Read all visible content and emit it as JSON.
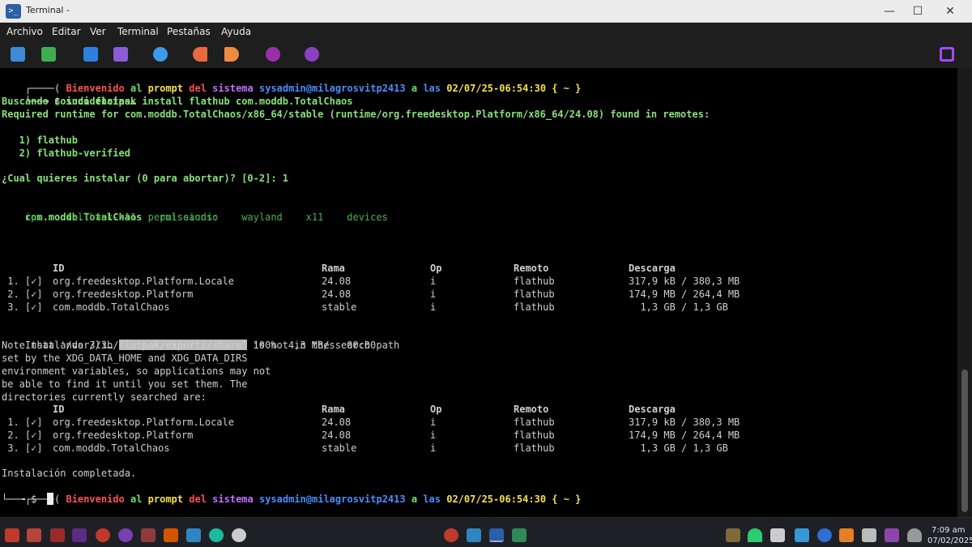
{
  "window": {
    "title": "Terminal -",
    "app_icon_glyph": ">_",
    "minimize": "—",
    "maximize": "☐",
    "close": "✕"
  },
  "menu": [
    "Archivo",
    "Editar",
    "Ver",
    "Terminal",
    "Pestañas",
    "Ayuda"
  ],
  "toolbar_icons": [
    "apps-icon",
    "grid-icon",
    "files-icon",
    "text-editor-icon",
    "search-icon",
    "left-arrow-icon",
    "right-arrow-icon",
    "settings-icon",
    "help-icon"
  ],
  "colors": {
    "prompt_red": "#ff5252",
    "prompt_green": "#6be06b",
    "prompt_blue": "#4d8cff",
    "prompt_purple": "#c070ff",
    "text_green": "#88e07a",
    "text_dim_green": "#4cb050"
  },
  "terminal": {
    "prompt1": {
      "open": "┌────( ",
      "words": [
        "Bienvenido",
        "al",
        "prompt",
        "del",
        "sistema",
        "sysadmin@milagrosvitp2413",
        "a",
        "las",
        "02/07/25-06:54:30"
      ],
      "close": " { ~ }"
    },
    "command_prefix": "└──╼ $ ",
    "command": "sudo flatpak install flathub com.moddb.TotalChaos",
    "searching": "Buscando coincidencias…",
    "required": "Required runtime for com.moddb.TotalChaos/x86_64/stable (runtime/org.freedesktop.Platform/x86_64/24.08) found in remotes:",
    "remote_option_1": "   1) flathub",
    "remote_option_2": "   2) flathub-verified",
    "question": "¿Cual quieres instalar (0 para abortar)? [0-2]: 1",
    "app_name": "com.moddb.TotalChaos",
    "permissions_label": " permissions:",
    "permissions": "    ipc    fallback-x11    pulseaudio    wayland    x11    devices",
    "table": {
      "headers": {
        "id": "ID",
        "rama": "Rama",
        "op": "Op",
        "remoto": "Remoto",
        "descarga": "Descarga"
      },
      "rows": [
        {
          "num": " 1. [✓]",
          "id": "org.freedesktop.Platform.Locale",
          "rama": "24.08",
          "op": "i",
          "remoto": "flathub",
          "descarga": "317,9 kB / 380,3 MB"
        },
        {
          "num": " 2. [✓]",
          "id": "org.freedesktop.Platform",
          "rama": "24.08",
          "op": "i",
          "remoto": "flathub",
          "descarga": "174,9 MB / 264,4 MB"
        },
        {
          "num": " 3. [✓]",
          "id": "com.moddb.TotalChaos",
          "rama": "stable",
          "op": "i",
          "remoto": "flathub",
          "descarga": "  1,3 GB / 1,3 GB"
        }
      ]
    },
    "installing_label": "Instalando 3/3…",
    "progress_fraction": 1.0,
    "progress_text": "100%  4,3 MB/s  00:00",
    "note_lines": [
      "Note that '/var/lib/flatpak/exports/share' is not in the search path",
      "set by the XDG_DATA_HOME and XDG_DATA_DIRS",
      "environment variables, so applications may not",
      "be able to find it until you set them. The",
      "directories currently searched are:"
    ],
    "completed": "Instalación completada.",
    "prompt2": {
      "open": "┌────( ",
      "words": [
        "Bienvenido",
        "al",
        "prompt",
        "del",
        "sistema",
        "sysadmin@milagrosvitp2413",
        "a",
        "las",
        "02/07/25-06:54:30"
      ],
      "close": " { ~ }"
    },
    "final_prefix": "└──╼ $ "
  },
  "taskbar": {
    "time": "7:09 am",
    "date": "07/02/2025"
  }
}
